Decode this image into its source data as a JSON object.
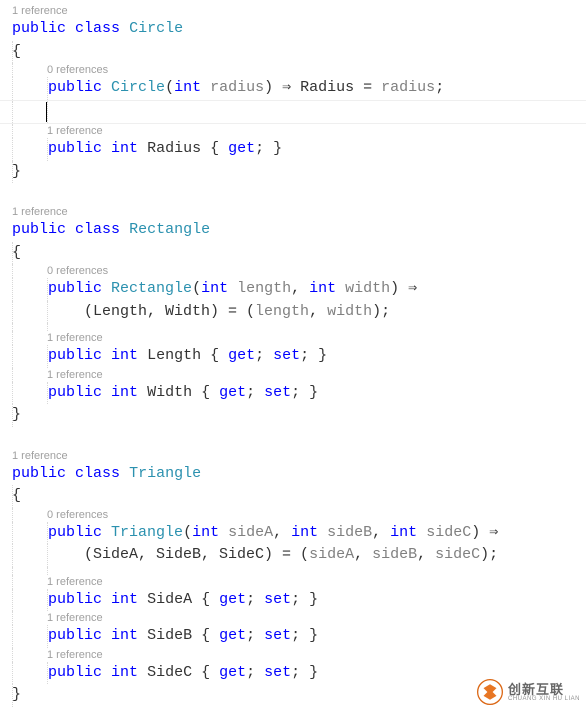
{
  "codelens": {
    "ref0": "0 references",
    "ref1": "1 reference"
  },
  "kw": {
    "public": "public",
    "class": "class",
    "int": "int",
    "get": "get",
    "set": "set"
  },
  "circle": {
    "name": "Circle",
    "ctor_sig_open": "public ",
    "ctor_name": "Circle",
    "ctor_params_open": "(",
    "ctor_p1_type": "int",
    "ctor_p1_name": " radius",
    "ctor_params_close": ") ",
    "arrow": "⇒",
    "ctor_body": " Radius = ",
    "ctor_body_param": "radius",
    "ctor_end": ";",
    "prop1_decl": "public ",
    "prop1_type": "int",
    "prop1_name": " Radius ",
    "prop1_body": "{ get; }"
  },
  "rectangle": {
    "name": "Rectangle",
    "ctor_name": "Rectangle",
    "ctor_paren_open": "(",
    "p1_type": "int",
    "p1_name": " length",
    "p_sep": ", ",
    "p2_type": "int",
    "p2_name": " width",
    "ctor_paren_close": ") ",
    "arrow": "⇒",
    "body_line2_a": "(Length, Width) = (",
    "body_line2_p1": "length",
    "body_line2_sep": ", ",
    "body_line2_p2": "width",
    "body_line2_end": ");",
    "prop1_name": " Length ",
    "prop2_name": " Width ",
    "prop_body": "{ get; set; }"
  },
  "triangle": {
    "name": "Triangle",
    "ctor_name": "Triangle",
    "p1_type": "int",
    "p1_name": " sideA",
    "p2_type": "int",
    "p2_name": " sideB",
    "p3_type": "int",
    "p3_name": " sideC",
    "arrow": "⇒",
    "body2_a": "(SideA, SideB, SideC) = (",
    "body2_p1": "sideA",
    "body2_s": ", ",
    "body2_p2": "sideB",
    "body2_p3": "sideC",
    "body2_end": ");",
    "propA": " SideA ",
    "propB": " SideB ",
    "propC": " SideC ",
    "prop_body": "{ get; set; }"
  },
  "brace_open": "{",
  "brace_close": "}",
  "watermark": {
    "cn": "创新互联",
    "en": "CHUANG XIN HU LIAN"
  }
}
